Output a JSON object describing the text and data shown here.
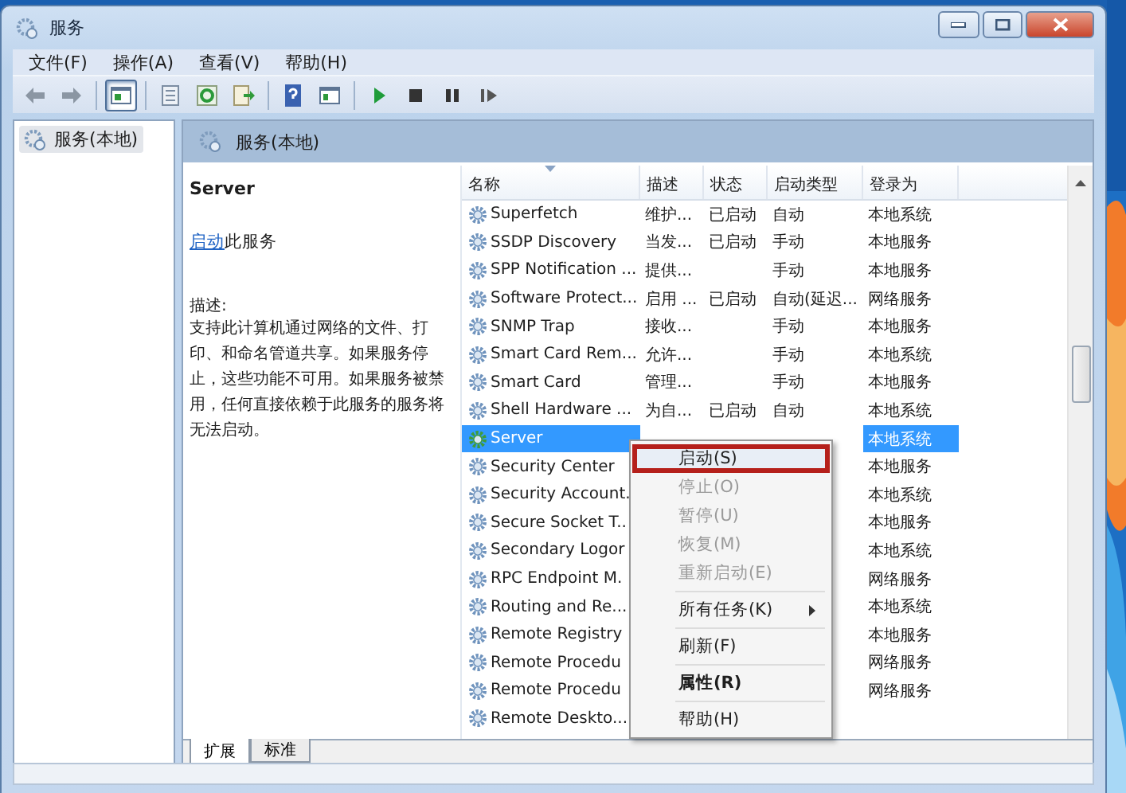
{
  "window": {
    "title": "服务"
  },
  "menu": [
    "文件(F)",
    "操作(A)",
    "查看(V)",
    "帮助(H)"
  ],
  "toolbar": [
    {
      "kind": "back",
      "pressed": false
    },
    {
      "kind": "forward",
      "pressed": false
    },
    {
      "kind": "separator"
    },
    {
      "kind": "tree",
      "pressed": true
    },
    {
      "kind": "separator"
    },
    {
      "kind": "properties",
      "pressed": false
    },
    {
      "kind": "refresh",
      "pressed": false
    },
    {
      "kind": "export",
      "pressed": false
    },
    {
      "kind": "separator"
    },
    {
      "kind": "help",
      "pressed": false
    },
    {
      "kind": "view",
      "pressed": false
    },
    {
      "kind": "separator"
    },
    {
      "kind": "play",
      "pressed": false
    },
    {
      "kind": "stop",
      "pressed": false
    },
    {
      "kind": "pause",
      "pressed": false
    },
    {
      "kind": "resume",
      "pressed": false
    }
  ],
  "tree": [
    {
      "label": "服务(本地)",
      "selected": true
    }
  ],
  "panel": {
    "title": "服务(本地)",
    "details": {
      "service_name": "Server",
      "action_link": "启动",
      "action_text": "此服务",
      "description_label": "描述:",
      "description": "支持此计算机通过网络的文件、打印、和命名管道共享。如果服务停止，这些功能不可用。如果服务被禁用，任何直接依赖于此服务的服务将无法启动。"
    },
    "table": {
      "columns": [
        "名称",
        "描述",
        "状态",
        "启动类型",
        "登录为"
      ],
      "rows": [
        {
          "name": "Superfetch",
          "description": "维护...",
          "status": "已启动",
          "startup": "自动",
          "logon": "本地系统",
          "selected": false
        },
        {
          "name": "SSDP Discovery",
          "description": "当发...",
          "status": "已启动",
          "startup": "手动",
          "logon": "本地服务",
          "selected": false
        },
        {
          "name": "SPP Notification ...",
          "description": "提供...",
          "startup": "手动",
          "logon": "本地服务",
          "selected": false
        },
        {
          "name": "Software Protect...",
          "description": "启用 ...",
          "status": "已启动",
          "startup": "自动(延迟...",
          "logon": "网络服务",
          "selected": false
        },
        {
          "name": "SNMP Trap",
          "description": "接收...",
          "startup": "手动",
          "logon": "本地服务",
          "selected": false
        },
        {
          "name": "Smart Card Rem...",
          "description": "允许...",
          "startup": "手动",
          "logon": "本地系统",
          "selected": false
        },
        {
          "name": "Smart Card",
          "description": "管理...",
          "startup": "手动",
          "logon": "本地服务",
          "selected": false
        },
        {
          "name": "Shell Hardware ...",
          "description": "为自...",
          "status": "已启动",
          "startup": "自动",
          "logon": "本地系统",
          "selected": false
        },
        {
          "name": "Server",
          "logon": "本地系统",
          "selected": true
        },
        {
          "name": "Security Center",
          "logon": "本地服务",
          "selected": false
        },
        {
          "name": "Security Account.",
          "logon": "本地系统",
          "selected": false
        },
        {
          "name": "Secure Socket T..",
          "logon": "本地服务",
          "selected": false
        },
        {
          "name": "Secondary Logor",
          "logon": "本地系统",
          "selected": false
        },
        {
          "name": "RPC Endpoint M.",
          "logon": "网络服务",
          "selected": false
        },
        {
          "name": "Routing and Re...",
          "logon": "本地系统",
          "selected": false
        },
        {
          "name": "Remote Registry",
          "logon": "本地服务",
          "selected": false
        },
        {
          "name": "Remote Procedu",
          "logon": "网络服务",
          "selected": false
        },
        {
          "name": "Remote Procedu",
          "logon": "网络服务",
          "selected": false
        },
        {
          "name": "Remote Deskto...",
          "selected": false
        }
      ]
    },
    "tabs": [
      {
        "label": "扩展",
        "selected": true
      },
      {
        "label": "标准",
        "selected": false
      }
    ]
  },
  "context_menu": [
    {
      "kind": "item",
      "label": "启动(S)",
      "disabled": false,
      "highlighted": true
    },
    {
      "kind": "item",
      "label": "停止(O)",
      "disabled": true,
      "highlighted": false
    },
    {
      "kind": "item",
      "label": "暂停(U)",
      "disabled": true,
      "highlighted": false
    },
    {
      "kind": "item",
      "label": "恢复(M)",
      "disabled": true,
      "highlighted": false
    },
    {
      "kind": "item",
      "label": "重新启动(E)",
      "disabled": true,
      "highlighted": false
    },
    {
      "kind": "separator"
    },
    {
      "kind": "submenu",
      "label": "所有任务(K)",
      "disabled": false,
      "highlighted": false
    },
    {
      "kind": "separator"
    },
    {
      "kind": "item",
      "label": "刷新(F)",
      "disabled": false,
      "highlighted": false
    },
    {
      "kind": "separator"
    },
    {
      "kind": "bold",
      "label": "属性(R)",
      "disabled": false,
      "highlighted": false
    },
    {
      "kind": "separator"
    },
    {
      "kind": "item",
      "label": "帮助(H)",
      "disabled": false,
      "highlighted": false
    }
  ]
}
